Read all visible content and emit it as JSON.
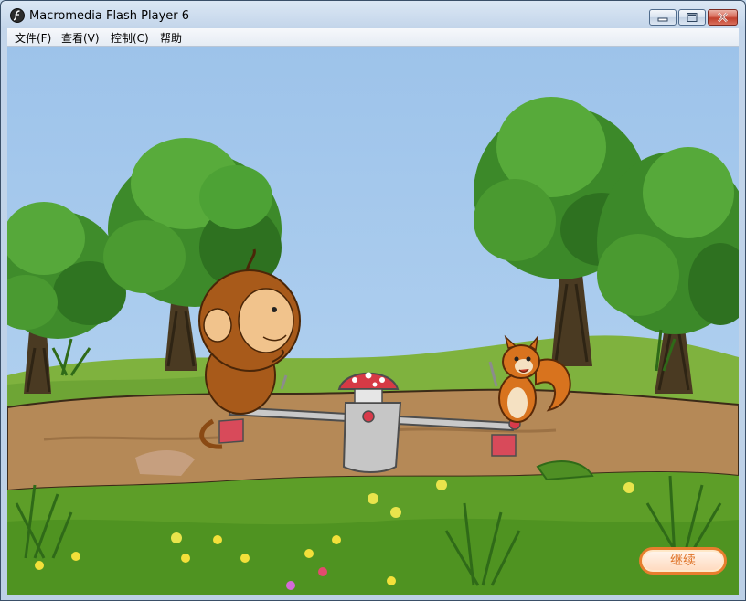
{
  "window": {
    "title": "Macromedia Flash Player 6",
    "icon": "flash-icon"
  },
  "window_controls": {
    "minimize_icon": "minimize-icon",
    "maximize_icon": "maximize-icon",
    "close_icon": "close-icon",
    "close_color": "#c8452f"
  },
  "menu": {
    "items": [
      {
        "label": "文件(F)"
      },
      {
        "label": "查看(V)"
      },
      {
        "label": "控制(C)"
      },
      {
        "label": "帮助"
      }
    ]
  },
  "scene": {
    "sky_color": "#9bbfe6",
    "grass_color": "#5f9e2a",
    "path_color": "#b68a5a",
    "characters": [
      "monkey",
      "squirrel"
    ],
    "object": "seesaw"
  },
  "continue_button": {
    "label": "继续",
    "accent": "#e77e2e"
  }
}
